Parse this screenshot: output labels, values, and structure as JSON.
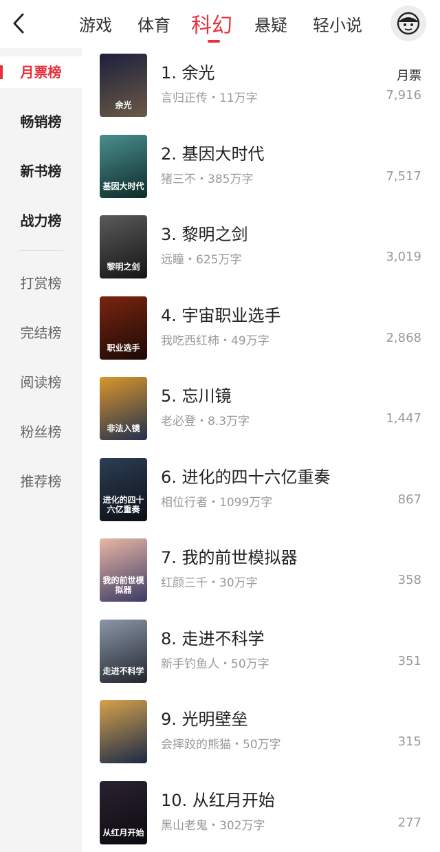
{
  "nav": {
    "tabs": [
      {
        "label": "游戏"
      },
      {
        "label": "体育"
      },
      {
        "label": "科幻"
      },
      {
        "label": "悬疑"
      },
      {
        "label": "轻小说"
      }
    ]
  },
  "sidebar": {
    "items": [
      {
        "label": "月票榜"
      },
      {
        "label": "畅销榜"
      },
      {
        "label": "新书榜"
      },
      {
        "label": "战力榜"
      },
      {
        "label": "打赏榜"
      },
      {
        "label": "完结榜"
      },
      {
        "label": "阅读榜"
      },
      {
        "label": "粉丝榜"
      },
      {
        "label": "推荐榜"
      }
    ]
  },
  "list": {
    "column_label": "月票",
    "books": [
      {
        "title": "1. 余光",
        "meta": "言归正传・11万字",
        "count": "7,916",
        "cover_text": "余光",
        "cover_colors": [
          "#1c1f3d",
          "#6b5a46"
        ]
      },
      {
        "title": "2. 基因大时代",
        "meta": "猪三不・385万字",
        "count": "7,517",
        "cover_text": "基因大时代",
        "cover_colors": [
          "#4a8f8f",
          "#0e2a2a"
        ]
      },
      {
        "title": "3. 黎明之剑",
        "meta": "远瞳・625万字",
        "count": "3,019",
        "cover_text": "黎明之剑",
        "cover_colors": [
          "#5a5a5a",
          "#151515"
        ]
      },
      {
        "title": "4. 宇宙职业选手",
        "meta": "我吃西红柿・49万字",
        "count": "2,868",
        "cover_text": "职业选手",
        "cover_colors": [
          "#7a2410",
          "#1a0a05"
        ]
      },
      {
        "title": "5. 忘川镜",
        "meta": "老必登・8.3万字",
        "count": "1,447",
        "cover_text": "非法入镜",
        "cover_colors": [
          "#d9962b",
          "#22304f"
        ]
      },
      {
        "title": "6. 进化的四十六亿重奏",
        "meta": "相位行者・1099万字",
        "count": "867",
        "cover_text": "进化的四十六亿重奏",
        "cover_colors": [
          "#2c3e55",
          "#0c0f14"
        ]
      },
      {
        "title": "7. 我的前世模拟器",
        "meta": "红颜三千・30万字",
        "count": "358",
        "cover_text": "我的前世模拟器",
        "cover_colors": [
          "#e9b7a3",
          "#3b3b66"
        ]
      },
      {
        "title": "8. 走进不科学",
        "meta": "新手钓鱼人・50万字",
        "count": "351",
        "cover_text": "走进不科学",
        "cover_colors": [
          "#8a96a8",
          "#22262e"
        ]
      },
      {
        "title": "9. 光明壁垒",
        "meta": "会摔跤的熊猫・50万字",
        "count": "315",
        "cover_text": "",
        "cover_colors": [
          "#d6a24a",
          "#1a2a48"
        ]
      },
      {
        "title": "10. 从红月开始",
        "meta": "黑山老鬼・302万字",
        "count": "277",
        "cover_text": "从红月开始",
        "cover_colors": [
          "#2a2230",
          "#0c0a10"
        ]
      }
    ]
  }
}
